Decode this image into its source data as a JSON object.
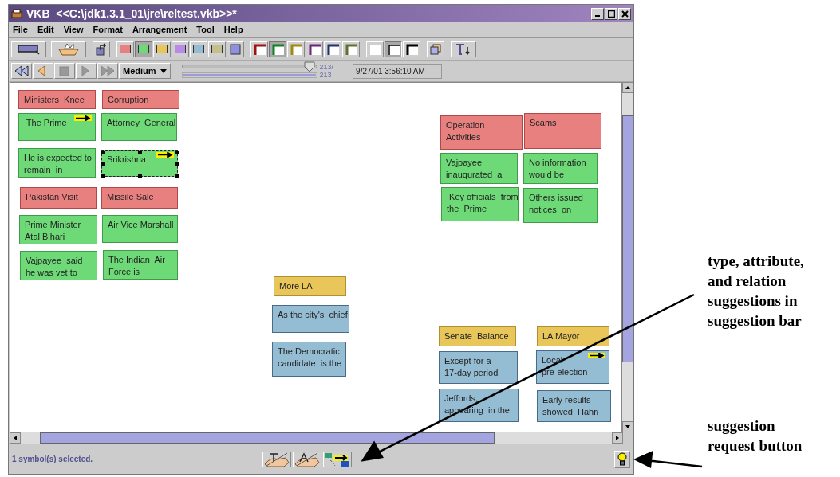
{
  "window": {
    "title": "VKB  <<C:\\jdk1.3.1_01\\jre\\reltest.vkb>>*"
  },
  "menu": [
    "File",
    "Edit",
    "View",
    "Format",
    "Arrangement",
    "Tool",
    "Help"
  ],
  "tools": [
    {
      "kind": "rectangle"
    },
    {
      "kind": "basket"
    },
    {
      "kind": "export"
    }
  ],
  "fill_colors": [
    {
      "color": "#e98080",
      "selected": false
    },
    {
      "color": "#6dd977",
      "selected": true
    },
    {
      "color": "#e8c65a",
      "selected": false
    },
    {
      "color": "#b98ae8",
      "selected": false
    },
    {
      "color": "#94bcd2",
      "selected": false
    },
    {
      "color": "#c4c08c",
      "selected": false
    }
  ],
  "border_colors": [
    {
      "color": "#a01010",
      "selected": false
    },
    {
      "color": "#108020",
      "selected": true
    },
    {
      "color": "#a08a10",
      "selected": false
    },
    {
      "color": "#702080",
      "selected": false
    },
    {
      "color": "#203070",
      "selected": false
    },
    {
      "color": "#607030",
      "selected": false
    }
  ],
  "border_widths": [
    {
      "kind": "none",
      "selected": false
    },
    {
      "kind": "thin",
      "selected": true
    },
    {
      "kind": "thick",
      "selected": false
    }
  ],
  "playback": [
    {
      "kind": "rewind",
      "disabled": false
    },
    {
      "kind": "back",
      "disabled": false
    },
    {
      "kind": "stop",
      "disabled": true
    },
    {
      "kind": "play",
      "disabled": true
    },
    {
      "kind": "forward",
      "disabled": true
    }
  ],
  "speed": "Medium",
  "timeline": {
    "level": 0.99,
    "reading": "213/\n213"
  },
  "history": {
    "level": 1
  },
  "timestamp": "9/27/01 3:56:10 AM",
  "cards": [
    {
      "text": "Ministers  Knee",
      "color": "#e98080",
      "arrow": false,
      "selected": false
    },
    {
      "text": "Corruption",
      "color": "#e98080",
      "arrow": false,
      "selected": false
    },
    {
      "text": " The Prime",
      "color": "#6dd977",
      "arrow": true,
      "selected": false
    },
    {
      "text": "Attorney  General",
      "color": "#6dd977",
      "arrow": false,
      "selected": false
    },
    {
      "text": "He is expected to\nremain  in",
      "color": "#6dd977",
      "arrow": false,
      "selected": false
    },
    {
      "text": "Srikrishna",
      "color": "#6dd977",
      "arrow": true,
      "selected": true
    },
    {
      "text": "Pakistan Visit",
      "color": "#e98080",
      "arrow": false,
      "selected": false
    },
    {
      "text": "Missile Sale",
      "color": "#e98080",
      "arrow": false,
      "selected": false
    },
    {
      "text": "Prime Minister\nAtal Bihari",
      "color": "#6dd977",
      "arrow": false,
      "selected": false
    },
    {
      "text": "Air Vice Marshall",
      "color": "#6dd977",
      "arrow": false,
      "selected": false
    },
    {
      "text": "Vajpayee  said\nhe was vet to",
      "color": "#6dd977",
      "arrow": false,
      "selected": false
    },
    {
      "text": "The Indian  Air\nForce is",
      "color": "#6dd977",
      "arrow": false,
      "selected": false
    },
    {
      "text": "Operation\nActivities",
      "color": "#e98080",
      "arrow": false,
      "selected": false
    },
    {
      "text": "Scams",
      "color": "#e98080",
      "arrow": false,
      "selected": false
    },
    {
      "text": "Vajpayee\ninauqurated  a",
      "color": "#6dd977",
      "arrow": false,
      "selected": false
    },
    {
      "text": "No information\nwould be",
      "color": "#6dd977",
      "arrow": false,
      "selected": false
    },
    {
      "text": " Key officials  from\nthe  Prime",
      "color": "#6dd977",
      "arrow": false,
      "selected": false
    },
    {
      "text": "Others issued\nnotices  on",
      "color": "#6dd977",
      "arrow": false,
      "selected": false
    },
    {
      "text": "More LA",
      "color": "#e8c65a",
      "arrow": false,
      "selected": false
    },
    {
      "text": "As the city's  chief",
      "color": "#94bcd2",
      "arrow": false,
      "selected": false
    },
    {
      "text": "The Democratic\ncandidate  is the",
      "color": "#94bcd2",
      "arrow": false,
      "selected": false
    },
    {
      "text": "Senate  Balance",
      "color": "#e8c65a",
      "arrow": false,
      "selected": false
    },
    {
      "text": "LA Mayor",
      "color": "#e8c65a",
      "arrow": false,
      "selected": false
    },
    {
      "text": "Except for a\n17-day period",
      "color": "#94bcd2",
      "arrow": false,
      "selected": false
    },
    {
      "text": "Local\npre-election",
      "color": "#94bcd2",
      "arrow": true,
      "selected": false
    },
    {
      "text": "Jeffords,\nappearing  in the",
      "color": "#94bcd2",
      "arrow": false,
      "selected": false
    },
    {
      "text": "Early results\nshowed  Hahn",
      "color": "#94bcd2",
      "arrow": false,
      "selected": false
    }
  ],
  "status": "1 symbol(s) selected.",
  "suggestions": [
    {
      "kind": "type"
    },
    {
      "kind": "attribute"
    },
    {
      "kind": "relation"
    }
  ],
  "annotations": [
    "type, attribute,\nand relation\nsuggestions in\nsuggestion bar",
    "suggestion\nrequest button"
  ]
}
